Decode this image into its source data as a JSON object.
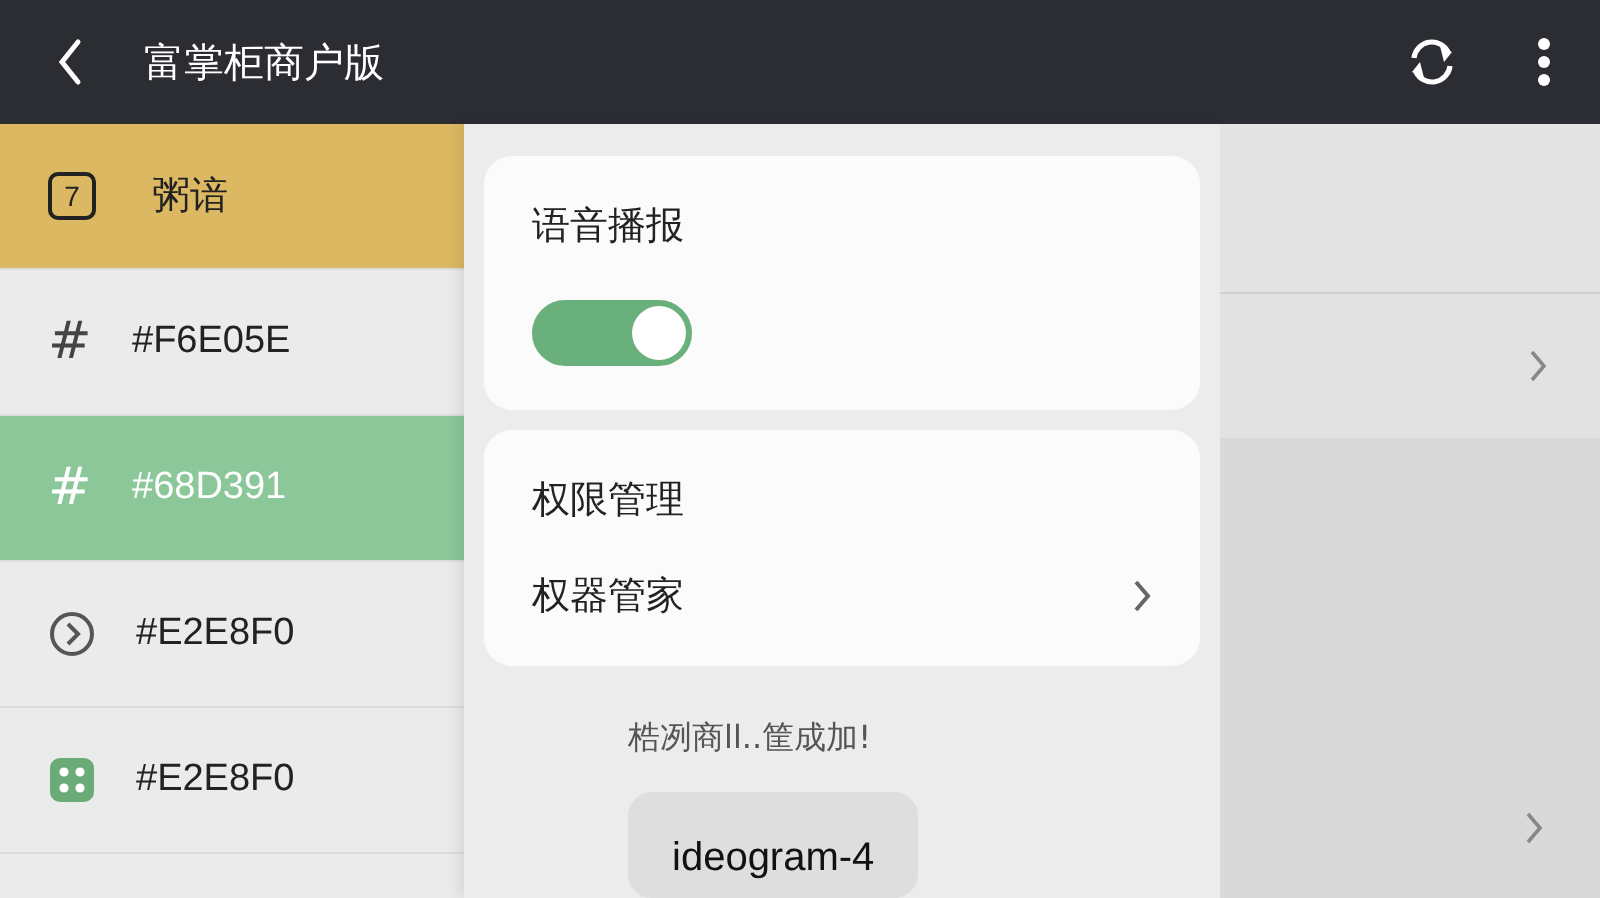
{
  "top_bar": {
    "title": "富掌柜商户版"
  },
  "sidebar": {
    "items": [
      {
        "kind": "badge",
        "icon_text": "7",
        "label": "粥谙",
        "selected": true,
        "color": "#dcb862"
      },
      {
        "kind": "hash",
        "icon_text": "#",
        "label": "#F6E05E",
        "selected": false
      },
      {
        "kind": "hash",
        "icon_text": "#",
        "label": "#68D391",
        "selected": true,
        "color": "#8cc79a"
      },
      {
        "kind": "circle",
        "label": "#E2E8F0",
        "selected": false
      },
      {
        "kind": "dots",
        "label": "#E2E8F0",
        "selected": false
      }
    ]
  },
  "panel": {
    "voice": {
      "title": "语音播报",
      "on": true
    },
    "permissions": {
      "title": "权限管理",
      "row": "权器管家"
    },
    "note": "梏冽商ll..筐成加!",
    "button": "ideogram-4"
  }
}
